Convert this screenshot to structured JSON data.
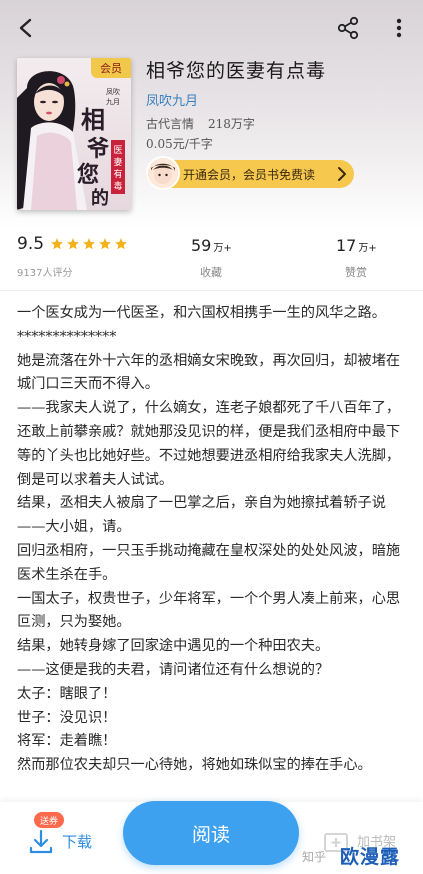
{
  "header": {
    "back_icon": "chevron-left-icon",
    "share_icon": "share-icon",
    "more_icon": "more-vertical-icon"
  },
  "book": {
    "title": "相爷您的医妻有点毒",
    "author": "凤吹九月",
    "genre": "古代言情",
    "word_count": "218万字",
    "price": "0.05元/千字",
    "cover_badge": "会员",
    "cover_title_art": "相爷您的医妻有点毒",
    "cover_author_art": "凤吹九月 著"
  },
  "vip_banner": {
    "text": "开通会员，会员书免费读",
    "accent": "#f6c84d"
  },
  "stats": {
    "rating": "9.5",
    "stars": 5,
    "rating_count": "9137人评分",
    "favorites_value": "59",
    "favorites_unit": "万+",
    "favorites_label": "收藏",
    "rewards_value": "17",
    "rewards_unit": "万+",
    "rewards_label": "赞赏"
  },
  "intro": {
    "paragraphs": [
      "一个医女成为一代医圣，和六国权相携手一生的风华之路。",
      "**************",
      "她是流落在外十六年的丞相嫡女宋晚致，再次回归，却被堵在城门口三天而不得入。",
      "——我家夫人说了，什么嫡女，连老子娘都死了千八百年了，还敢上前攀亲戚？就她那没见识的样，便是我们丞相府中最下等的丫头也比她好些。不过她想要进丞相府给我家夫人洗脚，倒是可以求着夫人试试。",
      "结果，丞相夫人被扇了一巴掌之后，亲自为她擦拭着轿子说——大小姐，请。",
      "回归丞相府，一只玉手挑动掩藏在皇权深处的处处风波，暗施医术生杀在手。",
      "一国太子，权贵世子，少年将军，一个个男人凑上前来，心思叵测，只为娶她。",
      "结果，她转身嫁了回家途中遇见的一个种田农夫。",
      "——这便是我的夫君，请问诸位还有什么想说的？",
      "太子：瞎眼了！",
      "世子：没见识！",
      "将军：走着瞧！",
      "然而那位农夫却只一心待她，将她如珠似宝的捧在手心。"
    ]
  },
  "bottom": {
    "download_label": "下载",
    "download_badge": "送券",
    "read_label": "阅读",
    "shelf_label": "加书架",
    "read_color": "#3ea1f0"
  },
  "watermark": {
    "zhihu": "知乎",
    "brand": "欧漫露"
  }
}
